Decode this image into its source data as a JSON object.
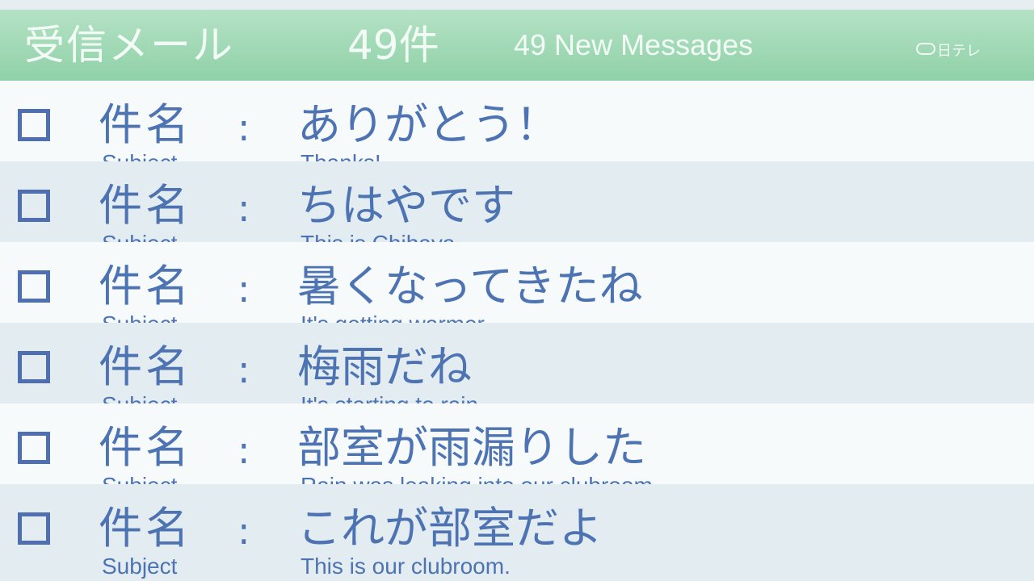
{
  "header": {
    "title": "受信メール",
    "count": "49件",
    "subtitle": "49 New Messages",
    "logo": "日テレ"
  },
  "messages": [
    {
      "label_jp": "件名",
      "label_en": "Subject",
      "colon": ":",
      "subject_jp": "ありがとう！",
      "subject_en": "Thanks!"
    },
    {
      "label_jp": "件名",
      "label_en": "Subject",
      "colon": ":",
      "subject_jp": "ちはやです",
      "subject_en": "This is Chihaya"
    },
    {
      "label_jp": "件名",
      "label_en": "Subject",
      "colon": ":",
      "subject_jp": "暑くなってきたね",
      "subject_en": "It's getting warmer"
    },
    {
      "label_jp": "件名",
      "label_en": "Subject",
      "colon": ":",
      "subject_jp": "梅雨だね",
      "subject_en": "It's starting to rain"
    },
    {
      "label_jp": "件名",
      "label_en": "Subject",
      "colon": ":",
      "subject_jp": "部室が雨漏りした",
      "subject_en": "Rain was leaking into our clubroom"
    },
    {
      "label_jp": "件名",
      "label_en": "Subject",
      "colon": ":",
      "subject_jp": "これが部室だよ",
      "subject_en": "This is our clubroom."
    }
  ],
  "colors": {
    "header_green": "#8fd1a8",
    "text_blue": "#4d73b3",
    "checkbox_blue": "#4f6fb0",
    "row_light": "#f6fafb",
    "row_dark": "#e3ecf1"
  }
}
